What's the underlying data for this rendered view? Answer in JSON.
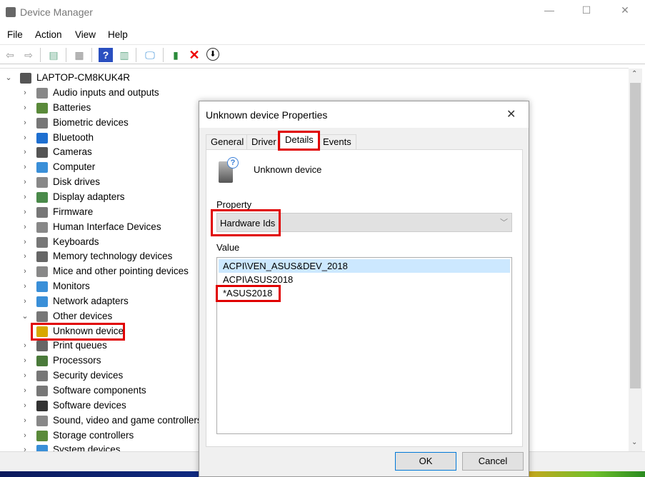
{
  "window": {
    "title": "Device Manager",
    "minimize": "—",
    "maximize": "☐",
    "close": "✕"
  },
  "menu": [
    "File",
    "Action",
    "View",
    "Help"
  ],
  "toolbar": [
    "back",
    "forward",
    "show-hide-console-tree",
    "properties",
    "help",
    "show-action-pane",
    "scan-hardware",
    "update-driver",
    "uninstall",
    "disable"
  ],
  "tree": {
    "root": "LAPTOP-CM8KUK4R",
    "items": [
      {
        "label": "Audio inputs and outputs",
        "icon": "speaker-icon",
        "color": "#888"
      },
      {
        "label": "Batteries",
        "icon": "battery-icon",
        "color": "#5a8a3a"
      },
      {
        "label": "Biometric devices",
        "icon": "fingerprint-icon",
        "color": "#777"
      },
      {
        "label": "Bluetooth",
        "icon": "bluetooth-icon",
        "color": "#1e6fd0"
      },
      {
        "label": "Cameras",
        "icon": "camera-icon",
        "color": "#555"
      },
      {
        "label": "Computer",
        "icon": "computer-icon",
        "color": "#3a8fd8"
      },
      {
        "label": "Disk drives",
        "icon": "disk-icon",
        "color": "#888"
      },
      {
        "label": "Display adapters",
        "icon": "display-adapter-icon",
        "color": "#4a8a4a"
      },
      {
        "label": "Firmware",
        "icon": "firmware-icon",
        "color": "#777"
      },
      {
        "label": "Human Interface Devices",
        "icon": "hid-icon",
        "color": "#888"
      },
      {
        "label": "Keyboards",
        "icon": "keyboard-icon",
        "color": "#777"
      },
      {
        "label": "Memory technology devices",
        "icon": "memory-icon",
        "color": "#666"
      },
      {
        "label": "Mice and other pointing devices",
        "icon": "mouse-icon",
        "color": "#888"
      },
      {
        "label": "Monitors",
        "icon": "monitor-icon",
        "color": "#3a8fd8"
      },
      {
        "label": "Network adapters",
        "icon": "network-icon",
        "color": "#3a8fd8"
      },
      {
        "label": "Other devices",
        "icon": "other-devices-icon",
        "color": "#777",
        "expanded": true
      },
      {
        "label": "Unknown device",
        "icon": "warning-device-icon",
        "color": "#d8a800",
        "child": true
      },
      {
        "label": "Print queues",
        "icon": "printer-icon",
        "color": "#666"
      },
      {
        "label": "Processors",
        "icon": "processor-icon",
        "color": "#4a7a3a"
      },
      {
        "label": "Security devices",
        "icon": "security-icon",
        "color": "#777"
      },
      {
        "label": "Software components",
        "icon": "software-component-icon",
        "color": "#777"
      },
      {
        "label": "Software devices",
        "icon": "software-device-icon",
        "color": "#333"
      },
      {
        "label": "Sound, video and game controllers",
        "icon": "sound-icon",
        "color": "#888"
      },
      {
        "label": "Storage controllers",
        "icon": "storage-icon",
        "color": "#5a8a3a"
      },
      {
        "label": "System devices",
        "icon": "system-icon",
        "color": "#3a8fd8"
      }
    ]
  },
  "dialog": {
    "title": "Unknown device Properties",
    "close": "✕",
    "tabs": [
      "General",
      "Driver",
      "Details",
      "Events"
    ],
    "active_tab": "Details",
    "device_name": "Unknown device",
    "property_label": "Property",
    "property_value": "Hardware Ids",
    "value_label": "Value",
    "values": [
      "ACPI\\VEN_ASUS&DEV_2018",
      "ACPI\\ASUS2018",
      "*ASUS2018"
    ],
    "ok": "OK",
    "cancel": "Cancel"
  },
  "highlight_color": "#e00000"
}
